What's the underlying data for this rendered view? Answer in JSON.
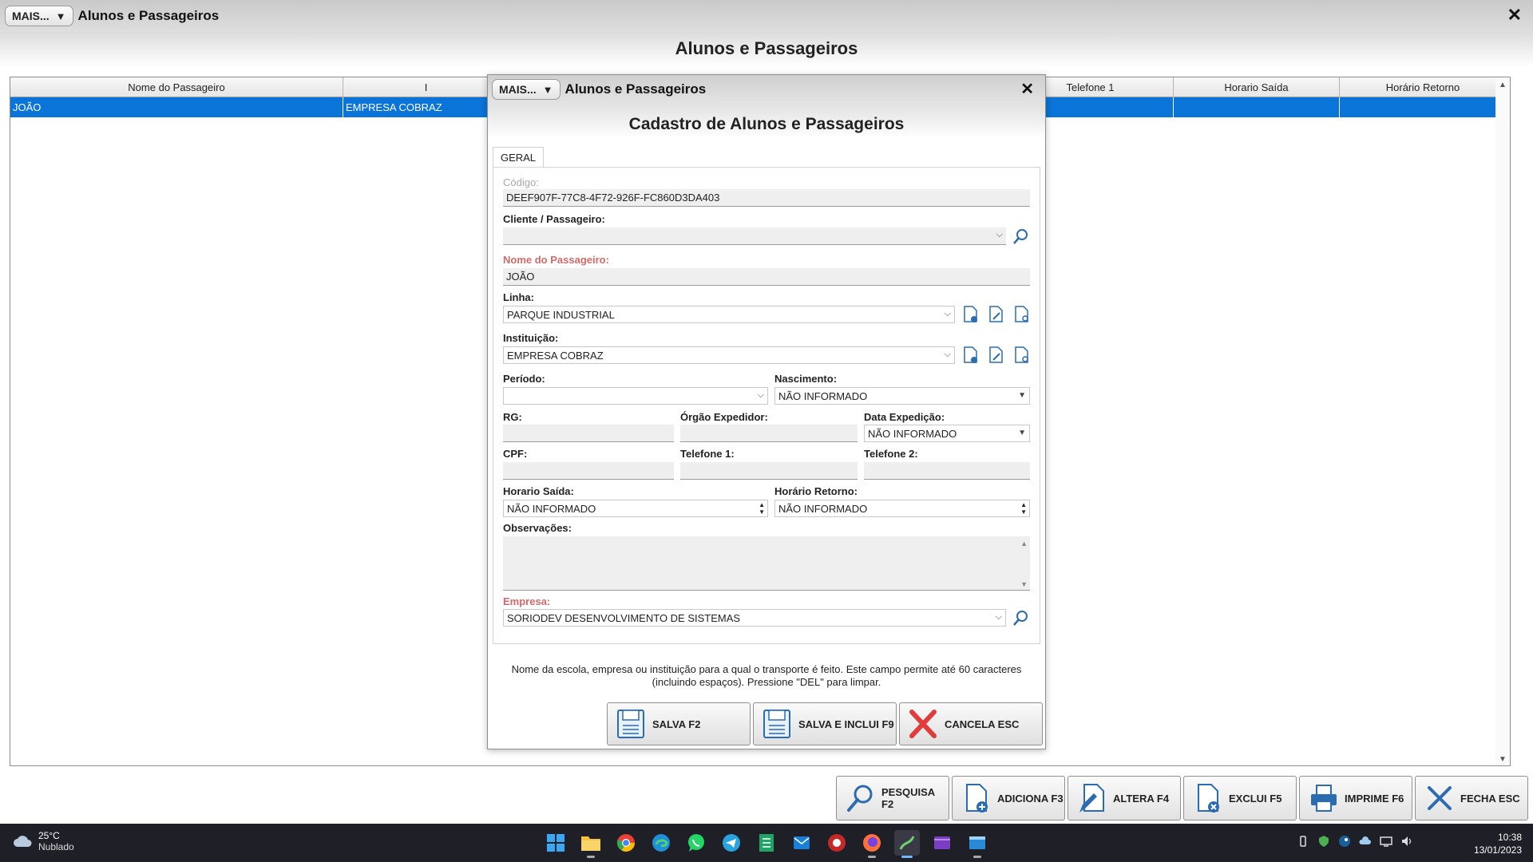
{
  "main_window": {
    "mais_label": "MAIS...",
    "title": "Alunos e Passageiros",
    "heading": "Alunos e Passageiros",
    "close": "✕"
  },
  "grid": {
    "columns": [
      "Nome do Passageiro",
      "I",
      "",
      "",
      "",
      "Telefone 1",
      "Horario Saída",
      "Horário Retorno"
    ],
    "row": [
      "JOÃO",
      "EMPRESA COBRAZ",
      "",
      "",
      "",
      "",
      "",
      ""
    ]
  },
  "toolbar": {
    "pesquisa": "PESQUISA F2",
    "adiciona": "ADICIONA F3",
    "altera": "ALTERA F4",
    "exclui": "EXCLUI F5",
    "imprime": "IMPRIME F6",
    "fecha": "FECHA ESC"
  },
  "modal": {
    "mais_label": "MAIS...",
    "title": "Alunos e Passageiros",
    "close": "✕",
    "heading": "Cadastro de Alunos e Passageiros",
    "tab": "GERAL",
    "fields": {
      "codigo_label": "Código:",
      "codigo_value": "DEEF907F-77C8-4F72-926F-FC860D3DA403",
      "cliente_label": "Cliente / Passageiro:",
      "cliente_value": "",
      "nome_label": "Nome do Passageiro:",
      "nome_value": "JOÃO",
      "linha_label": "Linha:",
      "linha_value": "PARQUE INDUSTRIAL",
      "instituicao_label": "Instituição:",
      "instituicao_value": "EMPRESA COBRAZ",
      "periodo_label": "Período:",
      "periodo_value": "",
      "nascimento_label": "Nascimento:",
      "nascimento_value": "NÃO INFORMADO",
      "rg_label": "RG:",
      "rg_value": "",
      "orgao_label": "Órgão Expedidor:",
      "orgao_value": "",
      "data_exp_label": "Data Expedição:",
      "data_exp_value": "NÃO INFORMADO",
      "cpf_label": "CPF:",
      "cpf_value": "",
      "tel1_label": "Telefone 1:",
      "tel1_value": "",
      "tel2_label": "Telefone 2:",
      "tel2_value": "",
      "saida_label": "Horario Saída:",
      "saida_value": "NÃO INFORMADO",
      "retorno_label": "Horário Retorno:",
      "retorno_value": "NÃO INFORMADO",
      "obs_label": "Observações:",
      "obs_value": "",
      "empresa_label": "Empresa:",
      "empresa_value": "SORIODEV DESENVOLVIMENTO DE SISTEMAS"
    },
    "hint": "Nome da escola, empresa ou instituição para a qual o transporte é feito. Este campo permite até 60 caracteres (incluindo espaços). Pressione \"DEL\" para limpar.",
    "buttons": {
      "salva": "SALVA F2",
      "salva_inclui": "SALVA E INCLUI F9",
      "cancela": "CANCELA ESC"
    }
  },
  "taskbar": {
    "temperature": "25°C",
    "condition": "Nublado",
    "time": "10:38",
    "date": "13/01/2023"
  },
  "colors": {
    "selection": "#0a74d8",
    "required_label": "#d36a6a",
    "taskbar": "#1f1f27"
  }
}
